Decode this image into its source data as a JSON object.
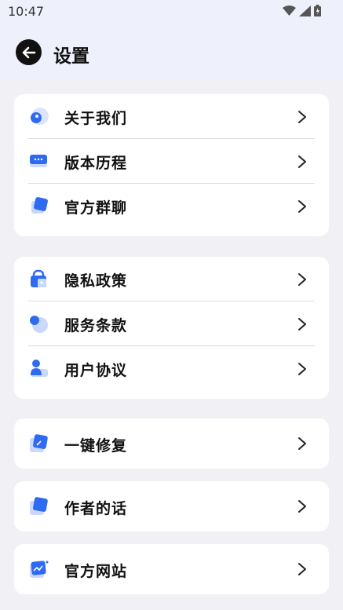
{
  "status": {
    "time": "10:47"
  },
  "header": {
    "title": "设置"
  },
  "colors": {
    "accent": "#2f6bf2",
    "accent_light": "#c9d8fb",
    "bg": "#f0f0f5",
    "header_bg": "#eef1fb"
  },
  "groups": [
    {
      "items": [
        {
          "label": "关于我们",
          "icon": "about-icon"
        },
        {
          "label": "版本历程",
          "icon": "version-icon"
        },
        {
          "label": "官方群聊",
          "icon": "group-chat-icon"
        }
      ]
    },
    {
      "items": [
        {
          "label": "隐私政策",
          "icon": "privacy-icon"
        },
        {
          "label": "服务条款",
          "icon": "terms-icon"
        },
        {
          "label": "用户协议",
          "icon": "user-agreement-icon"
        }
      ]
    },
    {
      "items": [
        {
          "label": "一键修复",
          "icon": "repair-icon"
        }
      ]
    },
    {
      "items": [
        {
          "label": "作者的话",
          "icon": "author-note-icon"
        }
      ]
    },
    {
      "items": [
        {
          "label": "官方网站",
          "icon": "website-icon"
        }
      ]
    }
  ]
}
